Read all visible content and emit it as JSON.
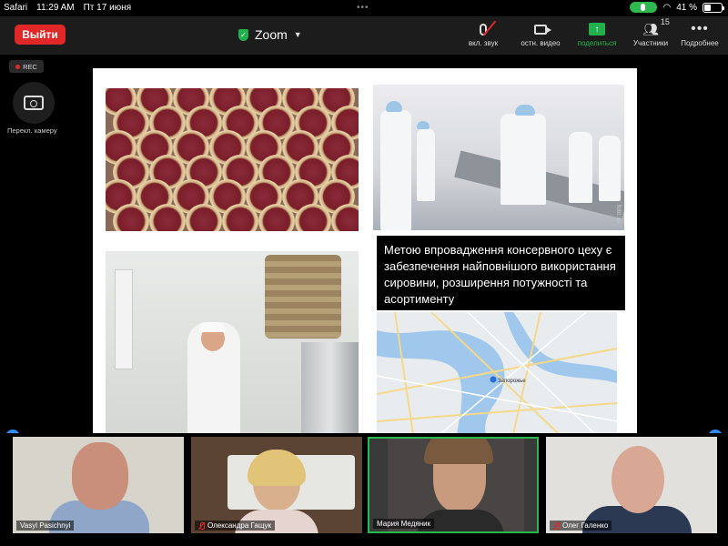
{
  "status_bar": {
    "app": "Safari",
    "time": "11:29 AM",
    "date": "Пт 17 июня",
    "battery": "41 %",
    "battery_level": 0.41
  },
  "toolbar": {
    "leave_label": "Выйти",
    "title": "Zoom",
    "items": [
      {
        "label": "вкл. звук"
      },
      {
        "label": "остн. видео"
      },
      {
        "label": "поделиться"
      },
      {
        "label": "Участники",
        "count": "15"
      },
      {
        "label": "Подробнее"
      }
    ]
  },
  "recording": {
    "label": "REC"
  },
  "flip_camera": {
    "label": "Перекл. камеру"
  },
  "slide": {
    "text": "Метою впровадження консервного цеху є забезпечення найповнішого використання сировини, розширення потужності та асортименту",
    "watermark": "foto.ru",
    "map_label": "Запорожье"
  },
  "participants": [
    {
      "name": "Vasyl Pasichnyi",
      "muted": false,
      "active": false
    },
    {
      "name": "Олександра Гащук",
      "muted": true,
      "active": false
    },
    {
      "name": "Мария Медяник",
      "muted": false,
      "active": true
    },
    {
      "name": "Олег Галенко",
      "muted": true,
      "active": false
    }
  ],
  "colors": {
    "leave": "#e02828",
    "share": "#22b04e",
    "active_speaker": "#27b94c",
    "accent": "#2d8cff"
  }
}
